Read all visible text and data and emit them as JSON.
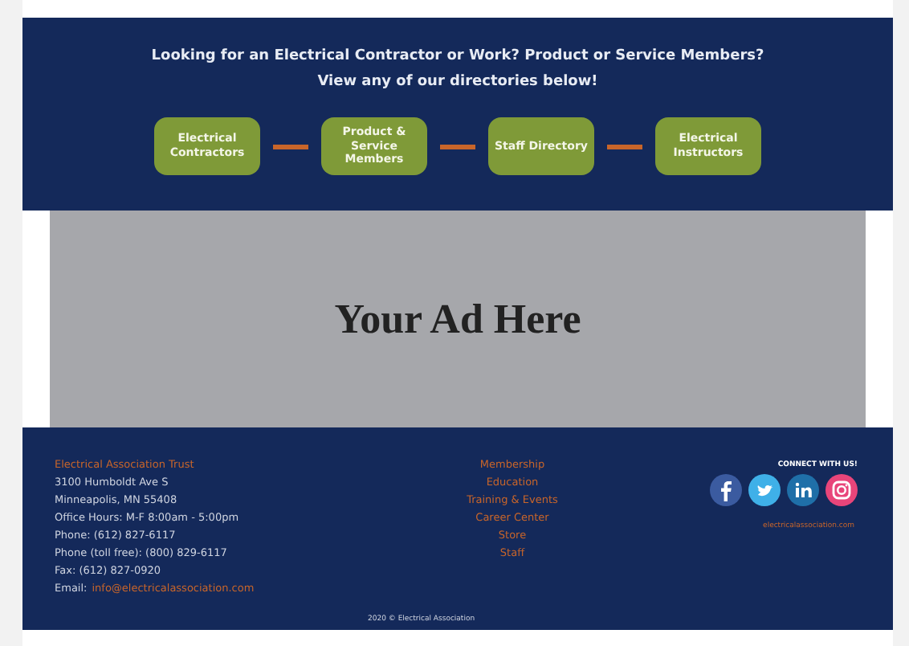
{
  "banner": {
    "heading": "Looking for an Electrical Contractor or Work? Product or Service Members?",
    "subheading": "View any of our directories below!",
    "directories": [
      {
        "label": "Electrical Contractors"
      },
      {
        "label": "Product & Service Members"
      },
      {
        "label": "Staff Directory"
      },
      {
        "label": "Electrical Instructors"
      }
    ]
  },
  "ad": {
    "text": "Your Ad Here"
  },
  "footer": {
    "contact": [
      {
        "kind": "title",
        "text": "Electrical Association Trust"
      },
      {
        "kind": "line",
        "text": "3100 Humboldt Ave S"
      },
      {
        "kind": "line",
        "text": "Minneapolis, MN 55408"
      },
      {
        "kind": "line",
        "text": "Office Hours: M-F 8:00am - 5:00pm"
      },
      {
        "kind": "line",
        "text": "Phone: (612) 827-6117"
      },
      {
        "kind": "line",
        "text": "Phone (toll free): (800) 829-6117"
      },
      {
        "kind": "line",
        "text": "Fax: (612) 827-0920"
      },
      {
        "kind": "email",
        "label": "Email:",
        "text": "info@electricalassociation.com"
      }
    ],
    "links": [
      "Membership",
      "Education",
      "Training & Events",
      "Career Center",
      "Store",
      "Staff"
    ],
    "connect": "CONNECT WITH US!",
    "social": [
      {
        "kind": "facebook"
      },
      {
        "kind": "twitter"
      },
      {
        "kind": "linkedin"
      },
      {
        "kind": "instagram"
      }
    ],
    "website": "electricalassociation.com",
    "copyright": "2020 © Electrical Association"
  }
}
